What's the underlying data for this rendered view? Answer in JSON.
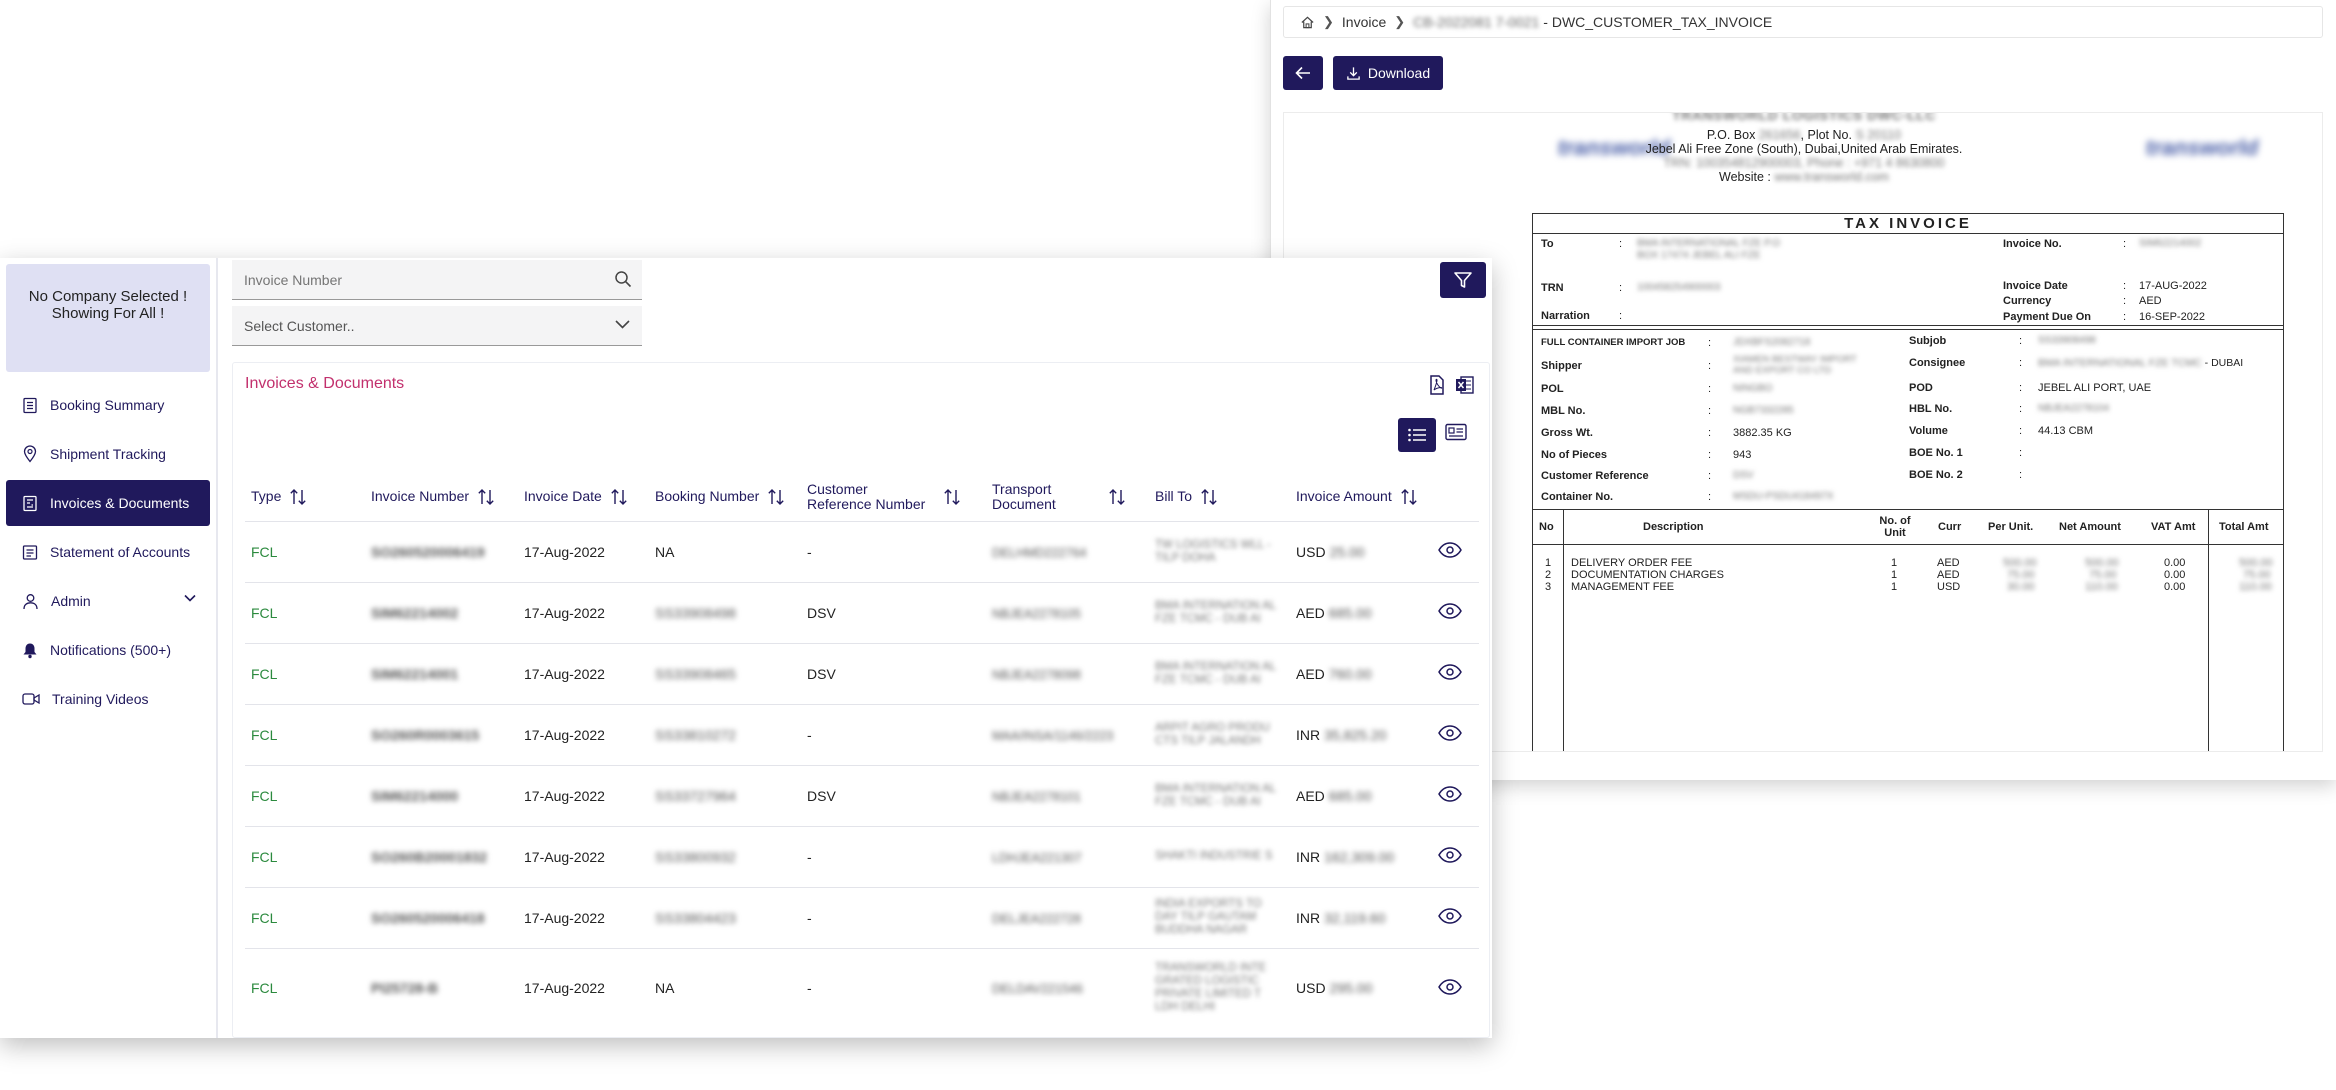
{
  "viewer": {
    "breadcrumb": {
      "section": "Invoice",
      "doc_id": "CB-2022081 7-0021",
      "doc_name": "- DWC_CUSTOMER_TAX_INVOICE"
    },
    "download_label": "Download",
    "document": {
      "company": "TRANSWORLD LOGISTICS DWC-LLC",
      "po_prefix": "P.O. Box",
      "po_value": "261656",
      "plot_prefix": ", Plot No.",
      "plot_value": "S 20110",
      "address": "Jebel Ali Free Zone (South), Dubai,United Arab Emirates.",
      "trn_prefix": "TRN:",
      "trn_value": "100354812900003",
      "phone_prefix": ", Phone :",
      "phone_value": "+971 4 8630800",
      "website_prefix": "Website :",
      "website_value": "www.transworld.com",
      "logo_text": "transworld",
      "title": "TAX INVOICE",
      "to_label": "To",
      "to_value": "BMA INTERNATIONAL FZE P.O BOX 17474 JEBEL ALI FZE",
      "trn_label": "TRN",
      "trn_val": "100458254900003",
      "narration_label": "Narration",
      "invoice_no_label": "Invoice No.",
      "invoice_no_value": "SIM62214002",
      "invoice_date_label": "Invoice Date",
      "invoice_date_value": "17-AUG-2022",
      "currency_label": "Currency",
      "currency_value": "AED",
      "payment_due_label": "Payment Due On",
      "payment_due_value": "16-SEP-2022",
      "fields_left": [
        {
          "label": "FULL CONTAINER IMPORT JOB",
          "value": "JDXBFS2082718"
        },
        {
          "label": "Shipper",
          "value": "XIAMEN BESTWAY IMPORT AND EXPORT CO LTD"
        },
        {
          "label": "POL",
          "value": "NINGBO"
        },
        {
          "label": "MBL No.",
          "value": "NGB7332285"
        },
        {
          "label": "Gross Wt.",
          "value": "3882.35 KG"
        },
        {
          "label": "No of Pieces",
          "value": "943"
        },
        {
          "label": "Customer Reference",
          "value": "DSV"
        },
        {
          "label": "Container No.",
          "value": "MSDU-PSDU418497X"
        }
      ],
      "fields_right": [
        {
          "label": "Subjob",
          "value": "SS33908498"
        },
        {
          "label": "Consignee",
          "value": "BMA INTERNATIONAL FZE TCMC",
          "suffix": "- DUBAI"
        },
        {
          "label": "POD",
          "value": "JEBEL ALI PORT, UAE"
        },
        {
          "label": "HBL No.",
          "value": "NBJEA2278104"
        },
        {
          "label": "Volume",
          "value": "44.13 CBM"
        },
        {
          "label": "BOE No. 1",
          "value": ""
        },
        {
          "label": "BOE No. 2",
          "value": ""
        }
      ],
      "line_headers": {
        "no": "No",
        "desc": "Description",
        "units": "No. of Unit",
        "curr": "Curr",
        "per_unit": "Per Unit.",
        "net": "Net Amount",
        "vat": "VAT Amt",
        "total": "Total Amt"
      },
      "lines": [
        {
          "no": "1",
          "desc": "DELIVERY ORDER FEE",
          "units": "1",
          "curr": "AED",
          "per_unit": "500.00",
          "net": "500.00",
          "vat": "0.00",
          "total": "500.00"
        },
        {
          "no": "2",
          "desc": "DOCUMENTATION CHARGES",
          "units": "1",
          "curr": "AED",
          "per_unit": "75.00",
          "net": "75.00",
          "vat": "0.00",
          "total": "75.00"
        },
        {
          "no": "3",
          "desc": "MANAGEMENT FEE",
          "units": "1",
          "curr": "USD",
          "per_unit": "30.00",
          "net": "110.00",
          "vat": "0.00",
          "total": "110.00"
        }
      ]
    }
  },
  "sidebar": {
    "company_notice_1": "No Company Selected !",
    "company_notice_2": "Showing For All !",
    "items": [
      {
        "label": "Booking Summary"
      },
      {
        "label": "Shipment Tracking"
      },
      {
        "label": "Invoices & Documents"
      },
      {
        "label": "Statement of Accounts"
      },
      {
        "label": "Admin"
      },
      {
        "label": "Notifications (500+)"
      },
      {
        "label": "Training Videos"
      }
    ]
  },
  "filters": {
    "invoice_placeholder": "Invoice Number",
    "customer_placeholder": "Select Customer.."
  },
  "card": {
    "title": "Invoices & Documents"
  },
  "table": {
    "headers": [
      "Type",
      "Invoice Number",
      "Invoice Date",
      "Booking Number",
      "Customer Reference Number",
      "Transport Document",
      "Bill To",
      "Invoice Amount"
    ],
    "rows": [
      {
        "type": "FCL",
        "invoice": "SO260520006419",
        "date": "17-Aug-2022",
        "booking": "NA",
        "booking_blur": false,
        "ref": "-",
        "transport": "DELHMD222764",
        "bill_to": "TW LOGISTICS WLL - TILP DOHA",
        "currency": "USD",
        "amount": "25.00"
      },
      {
        "type": "FCL",
        "invoice": "SIM62214002",
        "date": "17-Aug-2022",
        "booking": "SS33908498",
        "booking_blur": true,
        "ref": "DSV",
        "transport": "NBJEA2278105",
        "bill_to": "BMA INTERNATION AL FZE TCMC - DUB AI",
        "currency": "AED",
        "amount": "685.00"
      },
      {
        "type": "FCL",
        "invoice": "SIM62214001",
        "date": "17-Aug-2022",
        "booking": "SS33908465",
        "booking_blur": true,
        "ref": "DSV",
        "transport": "NBJEA2278098",
        "bill_to": "BMA INTERNATION AL FZE TCMC - DUB AI",
        "currency": "AED",
        "amount": "760.00"
      },
      {
        "type": "FCL",
        "invoice": "SO260R0003615",
        "date": "17-Aug-2022",
        "booking": "SS33810272",
        "booking_blur": true,
        "ref": "-",
        "transport": "MAA/INSA/1146/2223",
        "bill_to": "ARPIT AGRO PRODU CTS TILP JALANDH",
        "currency": "INR",
        "amount": "35,825.20"
      },
      {
        "type": "FCL",
        "invoice": "SIM62214000",
        "date": "17-Aug-2022",
        "booking": "SS33727964",
        "booking_blur": true,
        "ref": "DSV",
        "transport": "NBJEA2278101",
        "bill_to": "BMA INTERNATION AL FZE TCMC - DUB AI",
        "currency": "AED",
        "amount": "685.00"
      },
      {
        "type": "FCL",
        "invoice": "SO260B20001832",
        "date": "17-Aug-2022",
        "booking": "SS33800932",
        "booking_blur": true,
        "ref": "-",
        "transport": "LDHJEA221307",
        "bill_to": "SHAKTI INDUSTRIE S",
        "currency": "INR",
        "amount": "162,309.00"
      },
      {
        "type": "FCL",
        "invoice": "SO260520006418",
        "date": "17-Aug-2022",
        "booking": "SS33804423",
        "booking_blur": true,
        "ref": "-",
        "transport": "DELJEA222728",
        "bill_to": "INDIA EXPORTS TO DAY TILP GAUTAM BUDDHA NAGAR",
        "currency": "INR",
        "amount": "32,119.60"
      },
      {
        "type": "FCL",
        "invoice": "PI25728-B",
        "date": "17-Aug-2022",
        "booking": "NA",
        "booking_blur": false,
        "ref": "-",
        "transport": "DELDAV221546",
        "bill_to": "TRANSWORLD INTE GRATED LOGISTIC PRIVATE LIMITED T LDH DELHI",
        "currency": "USD",
        "amount": "295.00"
      }
    ]
  },
  "colors": {
    "primary": "#20195c",
    "accent_pink": "#c2306d",
    "type_green": "#2b8a3e",
    "sidebar_box": "#dfe0f3"
  }
}
